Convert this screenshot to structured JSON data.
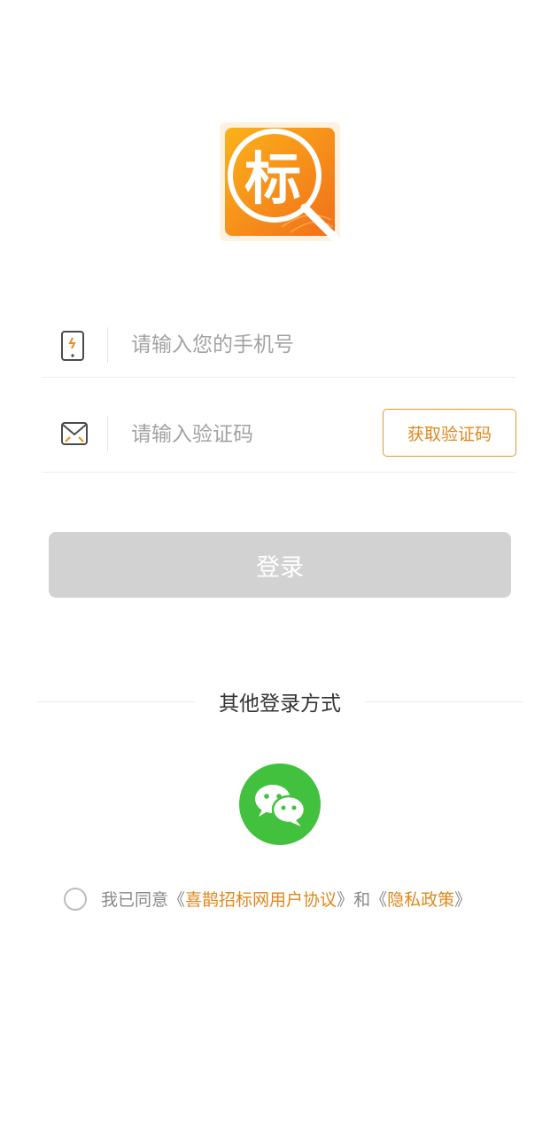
{
  "logo": {
    "char": "标"
  },
  "login_form": {
    "phone_placeholder": "请输入您的手机号",
    "code_placeholder": "请输入验证码",
    "get_code_label": "获取验证码",
    "login_label": "登录"
  },
  "other_login": {
    "title": "其他登录方式"
  },
  "agreement": {
    "prefix": "我已同意",
    "open": "《",
    "close": "》",
    "user_agreement": "喜鹊招标网用户协议",
    "conj": "和",
    "privacy_policy": "隐私政策"
  },
  "icons": {
    "phone": "phone-icon",
    "mail": "mail-icon",
    "wechat": "wechat-icon"
  },
  "colors": {
    "accent": "#e0871c",
    "logo_orange": "#f47f1e",
    "wechat_green": "#41c13d",
    "login_disabled": "#d2d2d2"
  }
}
